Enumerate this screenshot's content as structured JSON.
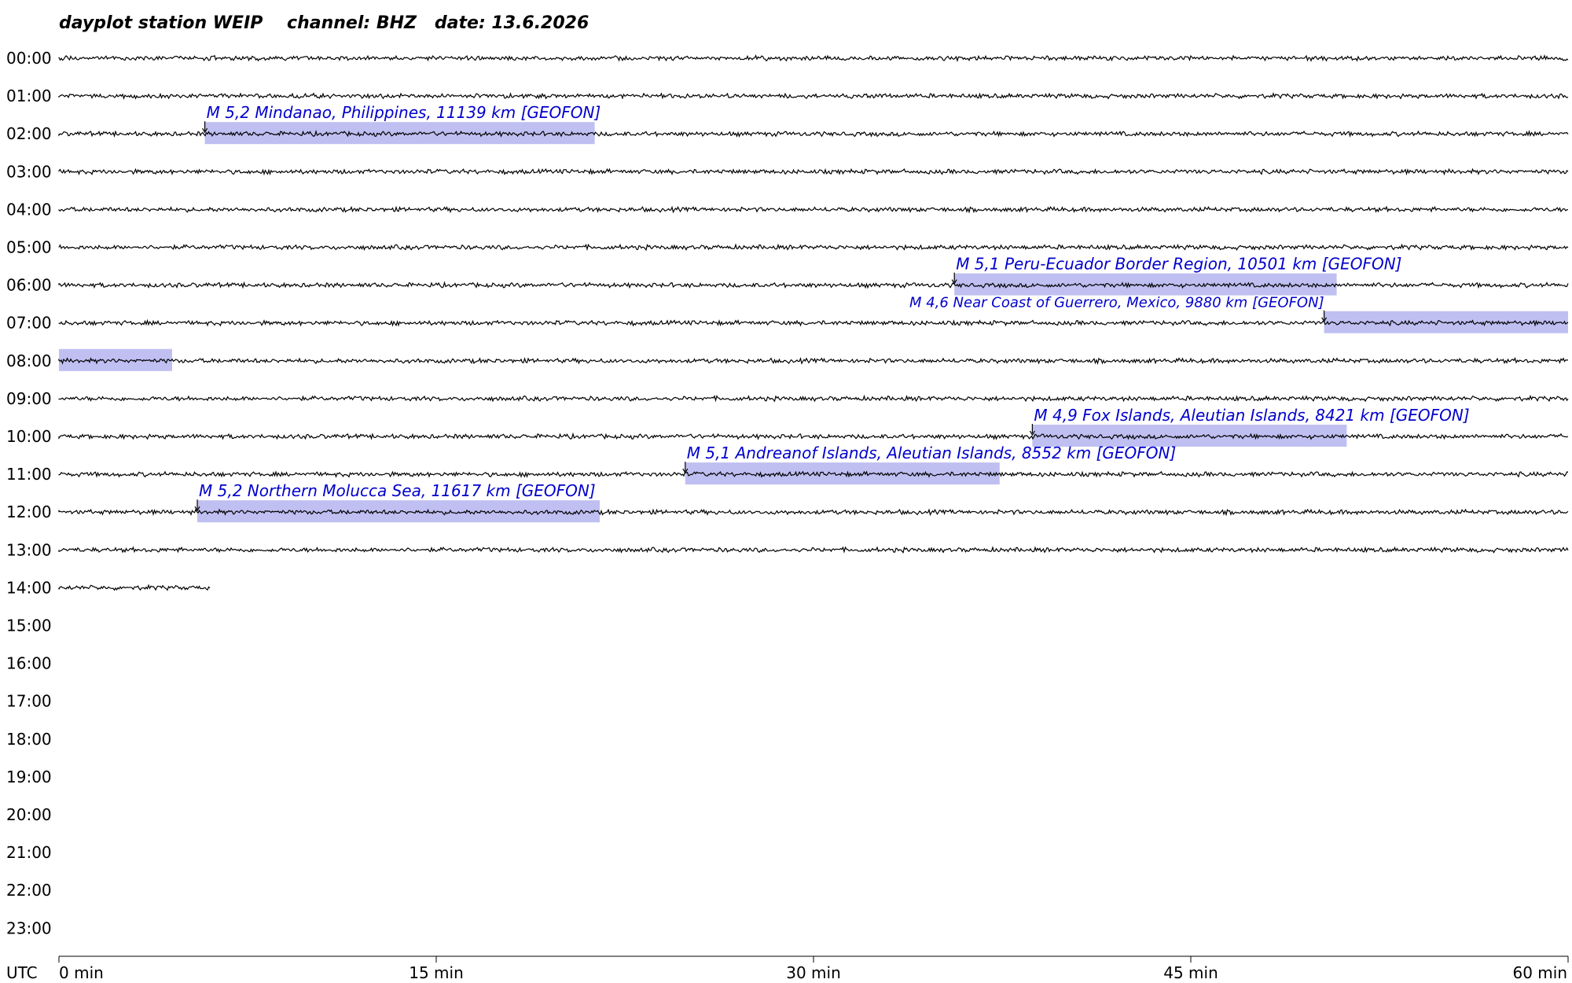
{
  "chart_data": {
    "type": "line",
    "title": "dayplot station WEIP    channel: BHZ   date: 13.6.2026",
    "station": "WEIP",
    "channel": "BHZ",
    "date": "13.6.2026",
    "timezone_label": "UTC",
    "row_labels": [
      "00:00",
      "01:00",
      "02:00",
      "03:00",
      "04:00",
      "05:00",
      "06:00",
      "07:00",
      "08:00",
      "09:00",
      "10:00",
      "11:00",
      "12:00",
      "13:00",
      "14:00",
      "15:00",
      "16:00",
      "17:00",
      "18:00",
      "19:00",
      "20:00",
      "21:00",
      "22:00",
      "23:00"
    ],
    "x_unit": "min",
    "xlim": [
      0,
      60
    ],
    "x_ticks": [
      0,
      15,
      30,
      45,
      60
    ],
    "x_tick_labels": [
      "0 min",
      "15 min",
      "30 min",
      "45 min",
      "60 min"
    ],
    "traces": [
      {
        "hour": 0,
        "start_min": 0,
        "end_min": 60
      },
      {
        "hour": 1,
        "start_min": 0,
        "end_min": 60
      },
      {
        "hour": 2,
        "start_min": 0,
        "end_min": 60
      },
      {
        "hour": 3,
        "start_min": 0,
        "end_min": 60
      },
      {
        "hour": 4,
        "start_min": 0,
        "end_min": 60
      },
      {
        "hour": 5,
        "start_min": 0,
        "end_min": 60
      },
      {
        "hour": 6,
        "start_min": 0,
        "end_min": 60
      },
      {
        "hour": 7,
        "start_min": 0,
        "end_min": 60
      },
      {
        "hour": 8,
        "start_min": 0,
        "end_min": 60
      },
      {
        "hour": 9,
        "start_min": 0,
        "end_min": 60
      },
      {
        "hour": 10,
        "start_min": 0,
        "end_min": 60
      },
      {
        "hour": 11,
        "start_min": 0,
        "end_min": 60
      },
      {
        "hour": 12,
        "start_min": 0,
        "end_min": 60
      },
      {
        "hour": 13,
        "start_min": 0,
        "end_min": 60
      },
      {
        "hour": 14,
        "start_min": 0,
        "end_min": 6
      }
    ],
    "events": [
      {
        "label": "M 5,2 Mindanao, Philippines, 11139 km  [GEOFON]",
        "hour": 2,
        "onset_min": 5.8,
        "window_end_min": 21.3,
        "label_side": "right"
      },
      {
        "label": "M 5,1 Peru-Ecuador Border Region, 10501 km  [GEOFON]",
        "hour": 6,
        "onset_min": 35.6,
        "window_end_min": 50.8,
        "label_side": "right"
      },
      {
        "label": "M 4,6 Near Coast of Guerrero, Mexico, 9880 km  [GEOFON]",
        "hour": 7,
        "onset_min": 50.3,
        "window_end_min": 64.5,
        "label_side": "left"
      },
      {
        "label": "M 4,9 Fox Islands, Aleutian Islands, 8421 km  [GEOFON]",
        "hour": 10,
        "onset_min": 38.7,
        "window_end_min": 51.2,
        "label_side": "right"
      },
      {
        "label": "M 5,1 Andreanof Islands, Aleutian Islands, 8552 km  [GEOFON]",
        "hour": 11,
        "onset_min": 24.9,
        "window_end_min": 37.4,
        "label_side": "right"
      },
      {
        "label": "M 5,2 Northern Molucca Sea, 11617 km  [GEOFON]",
        "hour": 12,
        "onset_min": 5.5,
        "window_end_min": 21.5,
        "label_side": "right"
      }
    ],
    "colors": {
      "trace": "#000000",
      "event_text": "#0000cc",
      "event_window": "#b4b4f0",
      "axis": "#000000"
    }
  }
}
